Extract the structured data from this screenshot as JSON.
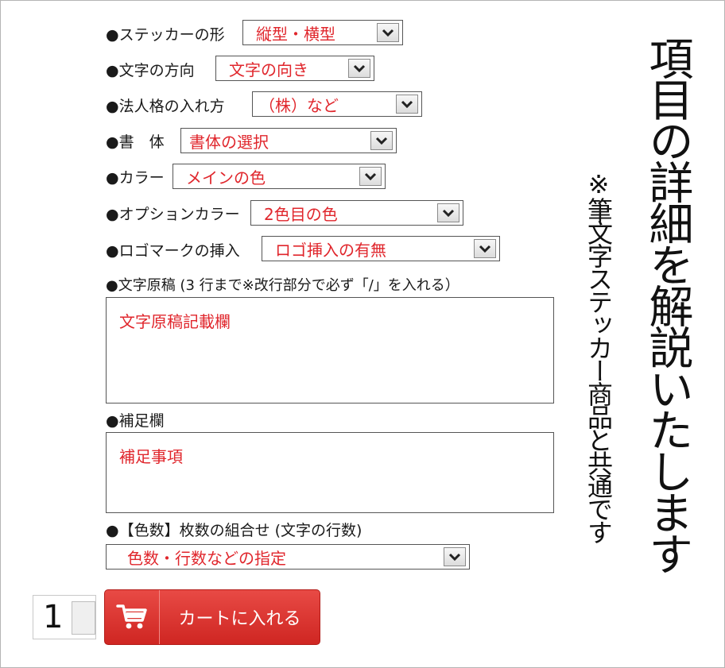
{
  "title": "項目の詳細を解説いたします",
  "subtitle": "※筆文字ステッカー商品と共通です",
  "fields": [
    {
      "label": "●ステッカーの形",
      "value": "縦型・横型"
    },
    {
      "label": "●文字の方向",
      "value": "文字の向き"
    },
    {
      "label": "●法人格の入れ方",
      "value": "（株）など"
    },
    {
      "label": "●書　体",
      "value": "書体の選択"
    },
    {
      "label": "●カラー",
      "value": "メインの色"
    },
    {
      "label": "●オプションカラー",
      "value": "2色目の色"
    },
    {
      "label": "●ロゴマークの挿入",
      "value": "ロゴ挿入の有無"
    }
  ],
  "text_original": {
    "label": "●文字原稿 (3 行まで※改行部分で必ず「/」を入れる）",
    "placeholder": "文字原稿記載欄"
  },
  "supplement": {
    "label": "●補足欄",
    "placeholder": "補足事項"
  },
  "combination": {
    "label": "●【色数】枚数の組合せ (文字の行数)",
    "value": "色数・行数などの指定"
  },
  "quantity": "1",
  "cart_button": "カートに入れる",
  "colors": {
    "accent": "#e0262c",
    "cart": "#d7302b"
  }
}
